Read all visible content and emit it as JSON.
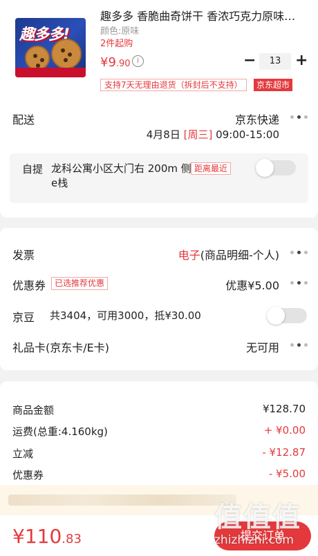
{
  "product": {
    "title": "趣多多 香脆曲奇饼干 香浓巧克力原味…",
    "thumb_brand": "趣多多!",
    "attribute": "颜色:原味",
    "min_qty": "2件起购",
    "price_currency": "¥",
    "price_int": "9",
    "price_dec": ".90",
    "info_icon": "i",
    "qty_minus": "−",
    "quantity": "13",
    "qty_plus": "+",
    "return_policy": "支持7天无理由退货（拆封后不支持）",
    "store_tag": "京东超市"
  },
  "delivery": {
    "label": "配送",
    "method": "京东快递",
    "date": "4月8日",
    "weekday": "[周三]",
    "time": "09:00-15:00",
    "pickup_label": "自提",
    "pickup_address": "龙科公寓小区大门右 200m 侧原e栈",
    "pickup_tag": "距离最近"
  },
  "invoice": {
    "label": "发票",
    "value_red": "电子",
    "value": "(商品明细-个人)"
  },
  "coupon": {
    "label": "优惠券",
    "tag": "已选推荐优惠",
    "value": "优惠¥5.00"
  },
  "jingdou": {
    "label": "京豆",
    "detail": "共3404，可用3000，抵¥30.00"
  },
  "giftcard": {
    "label": "礼品卡(京东卡/E卡)",
    "value": "无可用"
  },
  "summary": [
    {
      "label": "商品金额",
      "value": "¥128.70",
      "red": false
    },
    {
      "label": "运费(总重:4.160kg)",
      "value": "+ ¥0.00",
      "red": true
    },
    {
      "label": "立减",
      "value": "- ¥12.87",
      "red": true
    },
    {
      "label": "优惠券",
      "value": "- ¥5.00",
      "red": true
    }
  ],
  "footer": {
    "total_currency": "¥",
    "total_int": "110",
    "total_dec": ".83",
    "submit_label": "提交订单"
  },
  "watermark": {
    "big": "值值值",
    "url": "zhizhizhi.com"
  },
  "colors": {
    "accent": "#e4393c",
    "background": "#f2f2f2"
  }
}
